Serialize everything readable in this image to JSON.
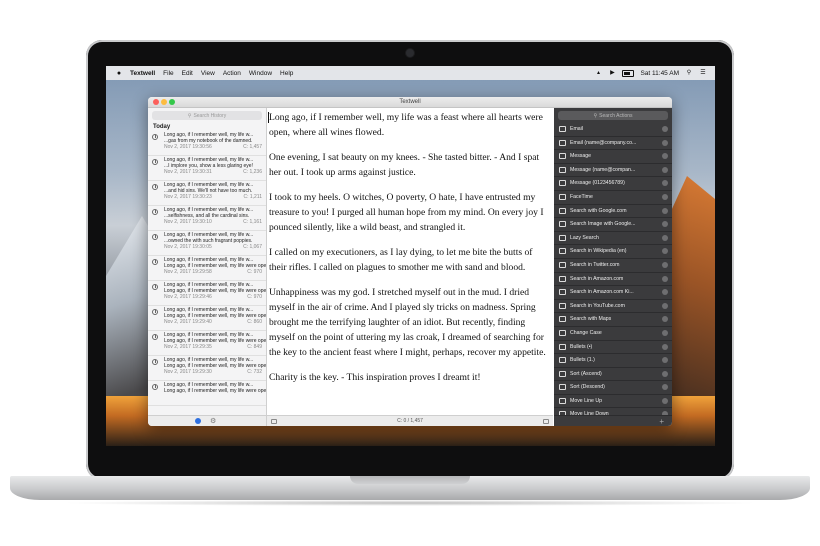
{
  "menubar": {
    "apple": "",
    "items": [
      "Textwell",
      "File",
      "Edit",
      "View",
      "Action",
      "Window",
      "Help"
    ],
    "clock": "Sat 11:45 AM"
  },
  "window": {
    "title": "Textwell"
  },
  "history": {
    "search_placeholder": "Search History",
    "section": "Today",
    "items": [
      {
        "line1": "Long ago, if I remember well, my life w...",
        "line2": "...gas from my notebook of the damned.",
        "date": "Nov 2, 2017 19:30:56",
        "count": "C: 1,457"
      },
      {
        "line1": "Long ago, if I remember well, my life w...",
        "line2": "...I implore you, show a less glaring eye!",
        "date": "Nov 2, 2017 19:30:31",
        "count": "C: 1,236"
      },
      {
        "line1": "Long ago, if I remember well, my life w...",
        "line2": "...and hid sins. We'll not have too much.",
        "date": "Nov 2, 2017 19:30:23",
        "count": "C: 1,211"
      },
      {
        "line1": "Long ago, if I remember well, my life w...",
        "line2": "...selfishness, and all the cardinal sins.",
        "date": "Nov 2, 2017 19:30:10",
        "count": "C: 1,161"
      },
      {
        "line1": "Long ago, if I remember well, my life w...",
        "line2": "...owned the with such fragrant poppies.",
        "date": "Nov 2, 2017 19:30:05",
        "count": "C: 1,067"
      },
      {
        "line1": "Long ago, if I remember well, my life w...",
        "line2": "Long ago, if I remember well, my life were ope...",
        "date": "Nov 2, 2017 19:29:58",
        "count": "C: 970"
      },
      {
        "line1": "Long ago, if I remember well, my life w...",
        "line2": "Long ago, if I remember well, my life were ope...",
        "date": "Nov 2, 2017 19:29:46",
        "count": "C: 970"
      },
      {
        "line1": "Long ago, if I remember well, my life w...",
        "line2": "Long ago, if I remember well, my life were ope...",
        "date": "Nov 2, 2017 19:29:40",
        "count": "C: 860"
      },
      {
        "line1": "Long ago, if I remember well, my life w...",
        "line2": "Long ago, if I remember well, my life were ope...",
        "date": "Nov 2, 2017 19:29:35",
        "count": "C: 849"
      },
      {
        "line1": "Long ago, if I remember well, my life w...",
        "line2": "Long ago, if I remember well, my life were ope...",
        "date": "Nov 2, 2017 19:29:30",
        "count": "C: 732"
      },
      {
        "line1": "Long ago, if I remember well, my life w...",
        "line2": "Long ago, if I remember well, my life were ope...",
        "date": "",
        "count": ""
      }
    ]
  },
  "editor": {
    "paragraphs": [
      "Long ago, if I remember well, my life was a feast where all hearts were open, where all wines flowed.",
      "One evening, I sat beauty on my knees. - She tasted bitter. - And I spat her out. I took up arms against justice.",
      "I took to my heels. O witches, O poverty, O hate, I have entrusted my treasure to you! I purged all human hope from my mind. On every joy I pounced silently, like a wild beast, and strangled it.",
      "I called on my executioners, as I lay dying, to let me bite the butts of their rifles. I called on plagues to smother me with sand and blood.",
      "Unhappiness was my god. I stretched myself out in the mud. I dried myself in the air of crime. And I played sly tricks on madness. Spring brought me the terrifying laughter of an idiot. But recently, finding myself on the point of uttering my las croak, I dreamed of searching for the key to the ancient feast where I might, perhaps, recover my appetite.",
      "Charity is the key. - This inspiration proves I dreamt it!"
    ],
    "status": "C: 0 / 1,457"
  },
  "actions": {
    "search_placeholder": "Search Actions",
    "items": [
      {
        "label": "Email",
        "icon": "envelope-icon"
      },
      {
        "label": "Email (name@company.co...",
        "icon": "envelope-icon"
      },
      {
        "label": "Message",
        "icon": "message-icon"
      },
      {
        "label": "Message (name@compan...",
        "icon": "message-icon"
      },
      {
        "label": "Message (0123456789)",
        "icon": "message-icon"
      },
      {
        "label": "FaceTime",
        "icon": "camera-icon"
      },
      {
        "label": "Search with Google.com",
        "icon": "search-icon"
      },
      {
        "label": "Search Image with Google...",
        "icon": "search-icon"
      },
      {
        "label": "Lazy Search",
        "icon": "search-icon"
      },
      {
        "label": "Search in Wikipedia (en)",
        "icon": "search-icon"
      },
      {
        "label": "Search in Twitter.com",
        "icon": "search-icon"
      },
      {
        "label": "Search in Amazon.com",
        "icon": "search-icon"
      },
      {
        "label": "Search in Amazon.com Ki...",
        "icon": "search-icon"
      },
      {
        "label": "Search in YouTube.com",
        "icon": "search-icon"
      },
      {
        "label": "Search with Maps",
        "icon": "map-icon"
      },
      {
        "label": "Change Case",
        "icon": "edit-icon"
      },
      {
        "label": "Bullets (•)",
        "icon": "edit-icon"
      },
      {
        "label": "Bullets (1.)",
        "icon": "edit-icon"
      },
      {
        "label": "Sort (Ascend)",
        "icon": "edit-icon"
      },
      {
        "label": "Sort (Descend)",
        "icon": "edit-icon"
      },
      {
        "label": "Move Line Up",
        "icon": "edit-icon"
      },
      {
        "label": "Move Line Down",
        "icon": "edit-icon"
      },
      {
        "label": "tyvm",
        "icon": "edit-icon"
      },
      {
        "label": "",
        "icon": "edit-icon"
      }
    ],
    "add_label": "+"
  }
}
